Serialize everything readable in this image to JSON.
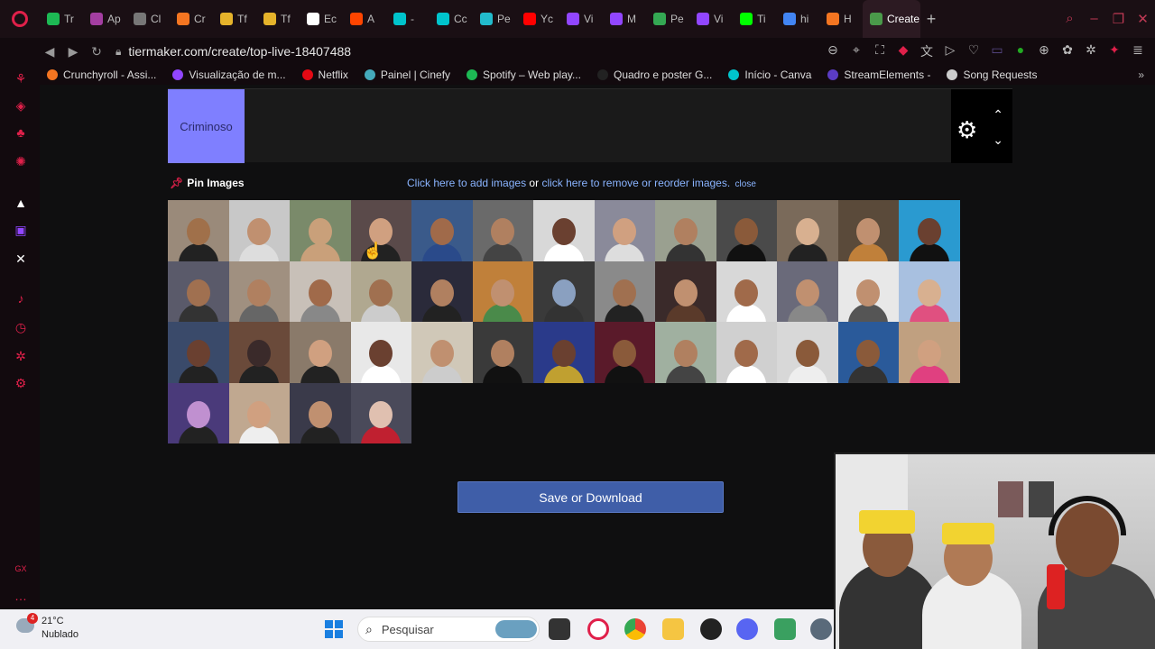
{
  "browser": {
    "tabs": [
      {
        "label": "Tr",
        "color": "#1db954"
      },
      {
        "label": "Ap",
        "color": "#a33ea1"
      },
      {
        "label": "Cl",
        "color": "#777"
      },
      {
        "label": "Cr",
        "color": "#f47521"
      },
      {
        "label": "Tf",
        "color": "#e5b32b"
      },
      {
        "label": "Tf",
        "color": "#e5b32b"
      },
      {
        "label": "Ec",
        "color": "#fff"
      },
      {
        "label": "A",
        "color": "#ff4500"
      },
      {
        "label": "-",
        "color": "#00c4cc"
      },
      {
        "label": "Cc",
        "color": "#00c4cc"
      },
      {
        "label": "Pe",
        "color": "#2bc"
      },
      {
        "label": "Yc",
        "color": "#f00"
      },
      {
        "label": "Vi",
        "color": "#9146ff"
      },
      {
        "label": "M",
        "color": "#9146ff"
      },
      {
        "label": "Pe",
        "color": "#34a853"
      },
      {
        "label": "Vi",
        "color": "#9146ff"
      },
      {
        "label": "Ti",
        "color": "#0f0"
      },
      {
        "label": "hi",
        "color": "#4285f4"
      },
      {
        "label": "H",
        "color": "#f47521"
      }
    ],
    "active_tab": "Create",
    "url": "tiermaker.com/create/top-live-18407488",
    "bookmarks": [
      {
        "label": "Crunchyroll - Assi...",
        "color": "#f47521"
      },
      {
        "label": "Visualização de m...",
        "color": "#9146ff"
      },
      {
        "label": "Netflix",
        "color": "#e50914"
      },
      {
        "label": "Painel | Cinefy",
        "color": "#4ab"
      },
      {
        "label": "Spotify – Web play...",
        "color": "#1db954"
      },
      {
        "label": "Quadro e poster G...",
        "color": "#222"
      },
      {
        "label": "Início - Canva",
        "color": "#00c4cc"
      },
      {
        "label": "StreamElements -",
        "color": "#5b3cc4"
      },
      {
        "label": "Song Requests",
        "color": "#ccc"
      }
    ]
  },
  "tier": {
    "label": "Criminoso",
    "label_color": "#7f7fff"
  },
  "pin": {
    "label": "Pin Images",
    "link_add": "Click here to add images",
    "or_text": "or",
    "link_remove": "click here to remove or reorder images.",
    "close": "close"
  },
  "thumbnails": [
    {
      "bg": "#9a8a7a",
      "skin": "#a0704a",
      "shirt": "#222"
    },
    {
      "bg": "#c8c8c8",
      "skin": "#c09070",
      "shirt": "#ddd"
    },
    {
      "bg": "#7a8a6a",
      "skin": "#c9a07a",
      "shirt": "#c9a07a"
    },
    {
      "bg": "#5a4a4a",
      "skin": "#d0a080",
      "shirt": "#222"
    },
    {
      "bg": "#3a5a8a",
      "skin": "#a06a4a",
      "shirt": "#2a4a8a"
    },
    {
      "bg": "#6a6a6a",
      "skin": "#b08060",
      "shirt": "#444"
    },
    {
      "bg": "#d8d8d8",
      "skin": "#6a4030",
      "shirt": "#fff"
    },
    {
      "bg": "#8a8a9a",
      "skin": "#d0a080",
      "shirt": "#ddd"
    },
    {
      "bg": "#9aa090",
      "skin": "#b08060",
      "shirt": "#333"
    },
    {
      "bg": "#4a4a4a",
      "skin": "#8a5a3a",
      "shirt": "#111"
    },
    {
      "bg": "#7a6a5a",
      "skin": "#d8b090",
      "shirt": "#222"
    },
    {
      "bg": "#5a4a3a",
      "skin": "#c09070",
      "shirt": "#c0803a"
    },
    {
      "bg": "#2a9ad0",
      "skin": "#6a4030",
      "shirt": "#111"
    },
    {
      "bg": "#5a5a6a",
      "skin": "#a07050",
      "shirt": "#333"
    },
    {
      "bg": "#a09080",
      "skin": "#b08060",
      "shirt": "#666"
    },
    {
      "bg": "#c8c0b8",
      "skin": "#a06a4a",
      "shirt": "#888"
    },
    {
      "bg": "#b0a890",
      "skin": "#a07050",
      "shirt": "#ccc"
    },
    {
      "bg": "#2a2a3a",
      "skin": "#b08060",
      "shirt": "#222"
    },
    {
      "bg": "#c0803a",
      "skin": "#c09070",
      "shirt": "#4a8a4a"
    },
    {
      "bg": "#3a3a3a",
      "skin": "#8aa0c0",
      "shirt": "#333"
    },
    {
      "bg": "#8a8a8a",
      "skin": "#a07050",
      "shirt": "#222"
    },
    {
      "bg": "#3a2a2a",
      "skin": "#c09070",
      "shirt": "#5a3a2a"
    },
    {
      "bg": "#d8d8d8",
      "skin": "#a06a4a",
      "shirt": "#fff"
    },
    {
      "bg": "#6a6a7a",
      "skin": "#c09070",
      "shirt": "#888"
    },
    {
      "bg": "#e8e8e8",
      "skin": "#c09070",
      "shirt": "#555"
    },
    {
      "bg": "#a8c0e0",
      "skin": "#d8b090",
      "shirt": "#e05080"
    },
    {
      "bg": "#3a4a6a",
      "skin": "#6a4030",
      "shirt": "#222"
    },
    {
      "bg": "#6a4a3a",
      "skin": "#3a2a2a",
      "shirt": "#222"
    },
    {
      "bg": "#8a7a6a",
      "skin": "#d0a080",
      "shirt": "#222"
    },
    {
      "bg": "#e8e8e8",
      "skin": "#6a4030",
      "shirt": "#fff"
    },
    {
      "bg": "#d0c8b8",
      "skin": "#c09070",
      "shirt": "#ccc"
    },
    {
      "bg": "#3a3a3a",
      "skin": "#b08060",
      "shirt": "#111"
    },
    {
      "bg": "#2a3a8a",
      "skin": "#6a4030",
      "shirt": "#c0a030"
    },
    {
      "bg": "#5a1a2a",
      "skin": "#8a5a3a",
      "shirt": "#111"
    },
    {
      "bg": "#a0b0a0",
      "skin": "#b08060",
      "shirt": "#444"
    },
    {
      "bg": "#d0d0d0",
      "skin": "#a06a4a",
      "shirt": "#fff"
    },
    {
      "bg": "#d8d8d8",
      "skin": "#8a5a3a",
      "shirt": "#eee"
    },
    {
      "bg": "#2a5a9a",
      "skin": "#8a5a3a",
      "shirt": "#333"
    },
    {
      "bg": "#c0a080",
      "skin": "#d0a080",
      "shirt": "#e04080"
    },
    {
      "bg": "#4a3a7a",
      "skin": "#c090d0",
      "shirt": "#222"
    },
    {
      "bg": "#c0a890",
      "skin": "#d0a080",
      "shirt": "#eee"
    },
    {
      "bg": "#3a3a4a",
      "skin": "#c09070",
      "shirt": "#222"
    },
    {
      "bg": "#4a4a5a",
      "skin": "#e0c0b0",
      "shirt": "#c02030"
    }
  ],
  "actions": {
    "save_label": "Save or Download"
  },
  "taskbar": {
    "temperature": "21°C",
    "condition": "Nublado",
    "badge": "4",
    "search_placeholder": "Pesquisar"
  }
}
